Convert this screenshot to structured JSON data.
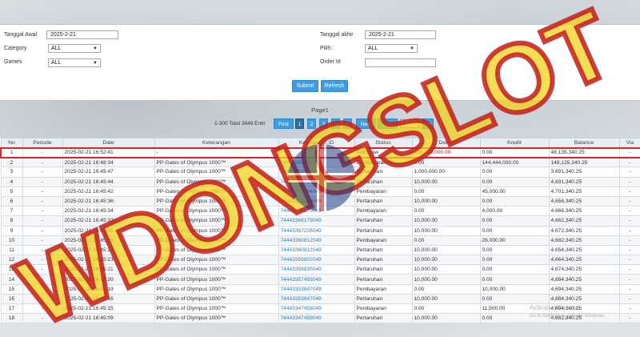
{
  "filters": {
    "tanggal_awal_label": "Tanggal Awal",
    "tanggal_awal_value": "2025-2-21",
    "tanggal_akhir_label": "Tanggal akhir",
    "tanggal_akhir_value": "2025-2-21",
    "category_label": "Category",
    "category_value": "ALL",
    "pilih_label": "Pilih :",
    "pilih_value": "ALL",
    "games_label": "Games",
    "games_value": "ALL",
    "order_id_label": "Order Id",
    "order_id_value": "",
    "submit_label": "Submit",
    "refresh_label": "Refresh"
  },
  "pager": {
    "title": "Page1",
    "total": "1-300 Total 3649 Entri",
    "first": "First",
    "pages": [
      "1",
      "2",
      "3",
      "4",
      "5"
    ],
    "next": "Next",
    "last": "Last",
    "goto_value": "1",
    "go": "Go"
  },
  "table": {
    "headers": [
      "No",
      "Periode",
      "Date",
      "Keterangan",
      "Keterangan ID",
      "Status",
      "Debet",
      "Kredit",
      "Balance",
      "Via"
    ],
    "rows": [
      [
        "1",
        "-",
        "2025-02-21 16:52:41",
        "-",
        "-",
        "Withdraw",
        "100,000,000.00",
        "0.00",
        "48,135,340.25",
        "-"
      ],
      [
        "2",
        "-",
        "2025-02-21 16:48:34",
        "PP-Gates of Olympus 1000™",
        "74443382473049",
        "Pembayaran",
        "0.00",
        "144,444,000.00",
        "148,135,340.25",
        "-"
      ],
      [
        "3",
        "-",
        "2025-02-21 16:45:47",
        "PP-Gates of Olympus 1000™",
        "74443382473049",
        "Pertaruhan",
        "1,000,000.00",
        "0.00",
        "3,691,340.25",
        "-"
      ],
      [
        "4",
        "-",
        "2025-02-21 16:45:44",
        "PP-Gates of Olympus 1000™",
        "74443379721049",
        "Pertaruhan",
        "10,000.00",
        "0.00",
        "4,691,340.25",
        "-"
      ],
      [
        "5",
        "-",
        "2025-02-21 16:45:42",
        "PP-Gates of Olympus 1000™",
        "74443371884049",
        "Pembayaran",
        "0.00",
        "45,000.00",
        "4,701,340.25",
        "-"
      ],
      [
        "6",
        "-",
        "2025-02-21 16:45:36",
        "PP-Gates of Olympus 1000™",
        "74443371884049",
        "Pertaruhan",
        "10,000.00",
        "0.00",
        "4,656,340.25",
        "-"
      ],
      [
        "7",
        "-",
        "2025-02-21 16:45:34",
        "PP-Gates of Olympus 1000™",
        "74443368179049",
        "Pembayaran",
        "0.00",
        "4,000.00",
        "4,666,340.25",
        "-"
      ],
      [
        "8",
        "-",
        "2025-02-21 16:45:32",
        "PP-Gates of Olympus 1000™",
        "74443368179049",
        "Pertaruhan",
        "10,000.00",
        "0.00",
        "4,662,340.25",
        "-"
      ],
      [
        "9",
        "-",
        "2025-02-21 16:45:31",
        "PP-Gates of Olympus 1000™",
        "74443367228049",
        "Pertaruhan",
        "10,000.00",
        "0.00",
        "4,672,340.25",
        "-"
      ],
      [
        "10",
        "-",
        "2025-02-21 16:45:29",
        "PP-Gates of Olympus 1000™",
        "74443360812049",
        "Pembayaran",
        "0.00",
        "28,000.00",
        "4,682,340.25",
        "-"
      ],
      [
        "11",
        "-",
        "2025-02-21 16:45:24",
        "PP-Gates of Olympus 1000™",
        "74443360812049",
        "Pertaruhan",
        "10,000.00",
        "0.00",
        "4,654,340.25",
        "-"
      ],
      [
        "12",
        "-",
        "2025-02-21 16:45:23",
        "PP-Gates of Olympus 1000™",
        "74443359802049",
        "Pertaruhan",
        "10,000.00",
        "0.00",
        "4,664,340.25",
        "-"
      ],
      [
        "13",
        "-",
        "2025-02-21 16:45:21",
        "PP-Gates of Olympus 1000™",
        "74443358835049",
        "Pertaruhan",
        "10,000.00",
        "0.00",
        "4,674,340.25",
        "-"
      ],
      [
        "14",
        "-",
        "2025-02-21 16:45:20",
        "PP-Gates of Olympus 1000™",
        "74443357493049",
        "Pertaruhan",
        "10,000.00",
        "0.00",
        "4,684,340.25",
        "-"
      ],
      [
        "15",
        "-",
        "2025-02-21 16:45:19",
        "PP-Gates of Olympus 1000™",
        "74443353847049",
        "Pembayaran",
        "0.00",
        "10,000.00",
        "4,694,340.25",
        "-"
      ],
      [
        "16",
        "-",
        "2025-02-21 16:45:16",
        "PP-Gates of Olympus 1000™",
        "74443353847049",
        "Pertaruhan",
        "10,000.00",
        "0.00",
        "4,684,340.25",
        "-"
      ],
      [
        "17",
        "-",
        "2025-02-21 16:45:15",
        "PP-Gates of Olympus 1000™",
        "74443347458049",
        "Pembayaran",
        "0.00",
        "11,500.00",
        "4,694,340.25",
        "-"
      ],
      [
        "18",
        "-",
        "2025-02-21 16:45:09",
        "PP-Gates of Olympus 1000™",
        "74443347458049",
        "Pertaruhan",
        "10,000.00",
        "0.00",
        "4,682,840.25",
        "-"
      ]
    ]
  },
  "watermark": {
    "text": "WDONGSLOT",
    "color": "#f2d21c",
    "stroke": "#c21d1d"
  },
  "activate_windows": {
    "line1": "Activate Windows",
    "line2": "Go to Settings to activate Windows."
  },
  "colors": {
    "accent": "#3d9de0",
    "highlight": "#d52a2a",
    "link": "#2d7fc1"
  }
}
